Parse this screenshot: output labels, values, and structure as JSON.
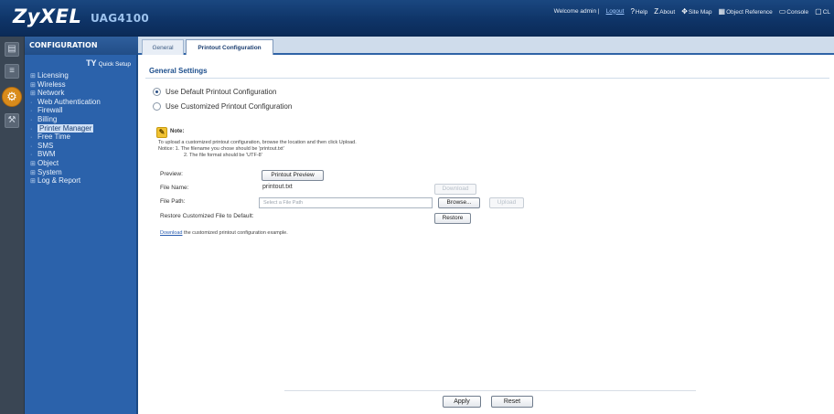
{
  "header": {
    "brand": "ZyXEL",
    "model": "UAG4100",
    "welcome_prefix": "Welcome admin |",
    "logout": "Logout",
    "links": [
      {
        "icon": "help-icon",
        "glyph": "?",
        "label": "Help"
      },
      {
        "icon": "about-icon",
        "glyph": "Z",
        "label": "About"
      },
      {
        "icon": "site-map-icon",
        "glyph": "✥",
        "label": "Site Map"
      },
      {
        "icon": "object-reference-icon",
        "glyph": "▦",
        "label": "Object Reference"
      },
      {
        "icon": "console-icon",
        "glyph": "▭",
        "label": "Console"
      },
      {
        "icon": "cli-icon",
        "glyph": "▢",
        "label": "CL"
      }
    ]
  },
  "nav": {
    "title": "CONFIGURATION",
    "quick_setup": "Quick Setup",
    "items": [
      {
        "label": "Licensing",
        "mark": "⊞"
      },
      {
        "label": "Wireless",
        "mark": "⊞"
      },
      {
        "label": "Network",
        "mark": "⊞"
      },
      {
        "label": "Web Authentication",
        "mark": "·"
      },
      {
        "label": "Firewall",
        "mark": "·"
      },
      {
        "label": "Billing",
        "mark": "·"
      },
      {
        "label": "Printer Manager",
        "mark": "·"
      },
      {
        "label": "Free Time",
        "mark": "·"
      },
      {
        "label": "SMS",
        "mark": "·"
      },
      {
        "label": "BWM",
        "mark": "·"
      },
      {
        "label": "Object",
        "mark": "⊞"
      },
      {
        "label": "System",
        "mark": "⊞"
      },
      {
        "label": "Log & Report",
        "mark": "⊞"
      }
    ],
    "selected_index": 6
  },
  "tabs": [
    {
      "label": "General",
      "active": false
    },
    {
      "label": "Printout Configuration",
      "active": true
    }
  ],
  "content": {
    "section_title": "General Settings",
    "radio_default": "Use Default Printout Configuration",
    "radio_custom": "Use Customized Printout Configuration",
    "radio_selected": "default",
    "note_title": "Note:",
    "note_line1": "To upload a customized printout configuration, browse the location and then click Upload.",
    "note_line2": "Notice:   1. The filename you chose should be 'printout.txt'",
    "note_line3": "2. The file format should be 'UTF-8'",
    "preview_label": "Preview:",
    "preview_button": "Printout Preview",
    "file_name_label": "File Name:",
    "file_name_value": "printout.txt",
    "download_button": "Download",
    "file_path_label": "File Path:",
    "file_path_placeholder": "Select a File Path",
    "browse_button": "Browse...",
    "upload_button": "Upload",
    "restore_label": "Restore Customized File to Default:",
    "restore_button": "Restore",
    "example_link": "Download",
    "example_text": " the customized printout configuration example."
  },
  "footer": {
    "apply": "Apply",
    "reset": "Reset"
  }
}
